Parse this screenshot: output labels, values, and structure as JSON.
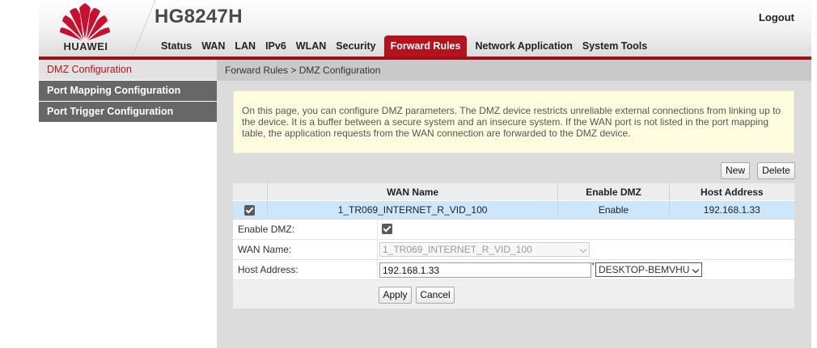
{
  "header": {
    "brand": "HUAWEI",
    "model": "HG8247H",
    "logout_label": "Logout",
    "brand_color": "#c8102e",
    "accent_color": "#b5121b"
  },
  "nav": {
    "tabs": [
      {
        "label": "Status"
      },
      {
        "label": "WAN"
      },
      {
        "label": "LAN"
      },
      {
        "label": "IPv6"
      },
      {
        "label": "WLAN"
      },
      {
        "label": "Security"
      },
      {
        "label": "Forward Rules",
        "active": true
      },
      {
        "label": "Network Application"
      },
      {
        "label": "System Tools"
      }
    ]
  },
  "sidebar": {
    "items": [
      {
        "label": "DMZ Configuration",
        "active": true
      },
      {
        "label": "Port Mapping Configuration"
      },
      {
        "label": "Port Trigger Configuration"
      }
    ]
  },
  "breadcrumb": "Forward Rules > DMZ Configuration",
  "info_text": "On this page, you can configure DMZ parameters. The DMZ device restricts unreliable external connections from linking up to the device. It is a buffer between a secure system and an insecure system. If the WAN port is not listed in the port mapping table, the application requests from the WAN connection are forwarded to the DMZ device.",
  "toolbar": {
    "new_label": "New",
    "delete_label": "Delete"
  },
  "table": {
    "headers": [
      "WAN Name",
      "Enable DMZ",
      "Host Address"
    ],
    "rows": [
      {
        "checked": true,
        "wan_name": "1_TR069_INTERNET_R_VID_100",
        "enable_dmz": "Enable",
        "host_address": "192.168.1.33"
      }
    ]
  },
  "form": {
    "enable_dmz_label": "Enable DMZ:",
    "enable_dmz_checked": true,
    "wan_name_label": "WAN Name:",
    "wan_name_value": "1_TR069_INTERNET_R_VID_100",
    "host_address_label": "Host Address:",
    "host_address_value": "192.168.1.33",
    "required_mark": "*",
    "device_select_value": "DESKTOP-BEMVHU",
    "apply_label": "Apply",
    "cancel_label": "Cancel"
  }
}
